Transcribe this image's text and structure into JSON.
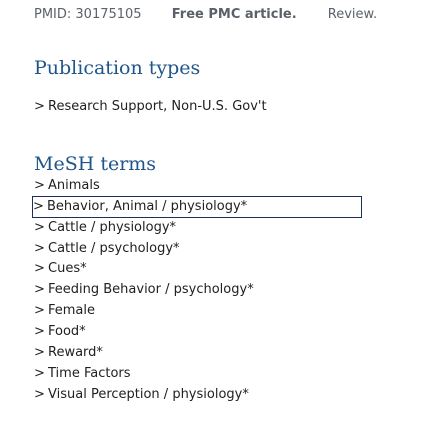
{
  "meta_row": {
    "pmid": "PMID: 30175105",
    "free_article": "Free PMC article.",
    "review": "Review."
  },
  "publication_types": {
    "title": "Publication types",
    "items": [
      "Research Support, Non-U.S. Gov't"
    ]
  },
  "mesh_terms": {
    "title": "MeSH terms",
    "focused_index": 1,
    "items": [
      "Animals",
      "Behavior, Animal / physiology*",
      "Cattle / physiology*",
      "Cattle / psychology*",
      "Cues*",
      "Feeding Behavior / psychology*",
      "Female",
      "Food*",
      "Reward*",
      "Time Factors",
      "Visual Perception / physiology*"
    ]
  },
  "chevron_icon": "chevron-right-icon",
  "colors": {
    "title": "#20558a",
    "meta_text": "#5b616b",
    "body_text": "#212121",
    "focus_outline": "#1f2d5a"
  }
}
